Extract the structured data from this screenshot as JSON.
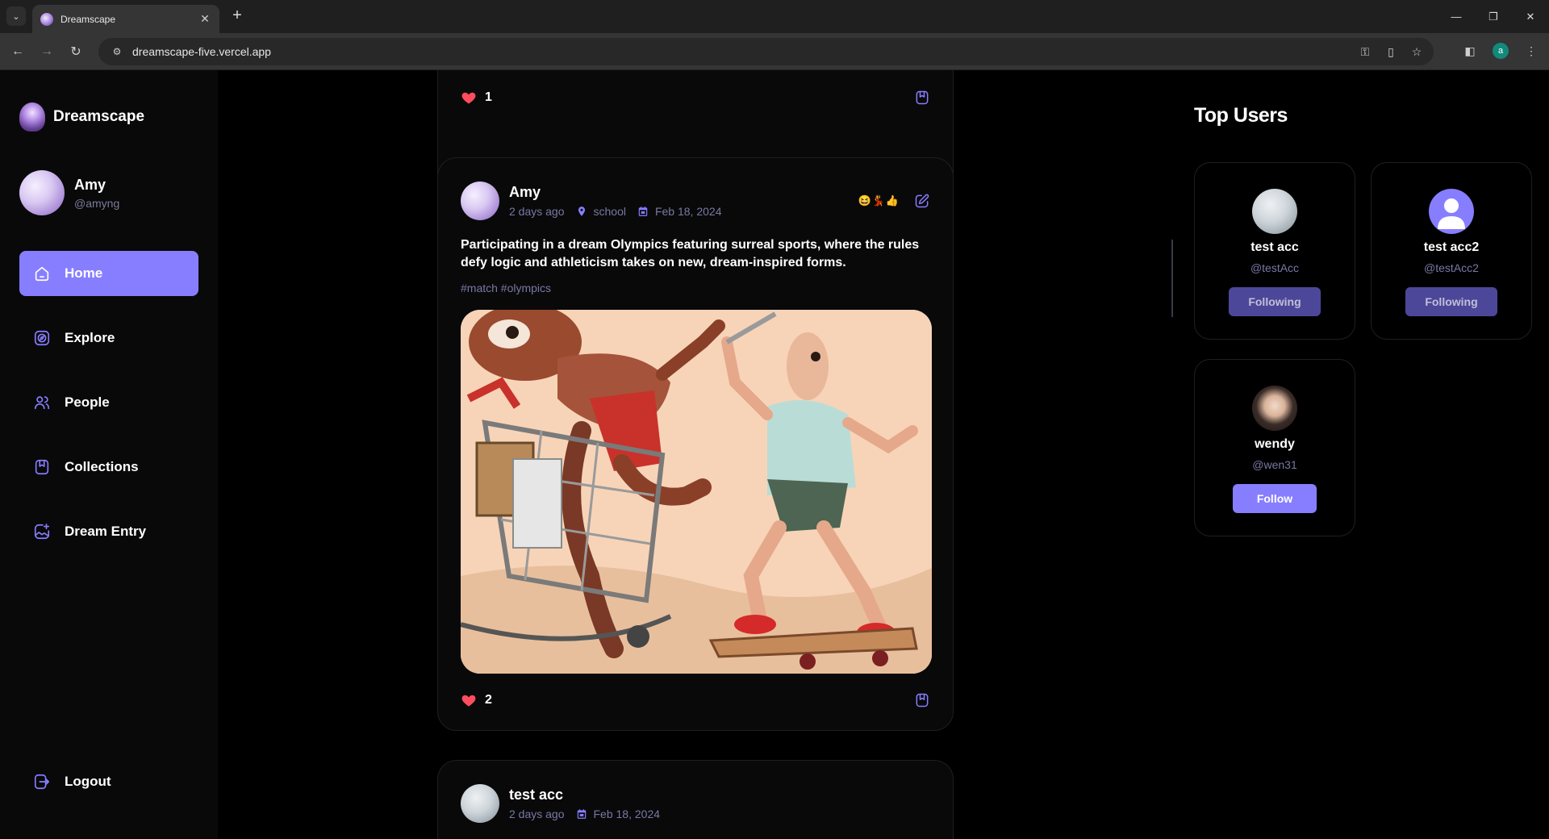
{
  "browser": {
    "tab_title": "Dreamscape",
    "url": "dreamscape-five.vercel.app",
    "profile_initial": "a"
  },
  "sidebar": {
    "brand": "Dreamscape",
    "user": {
      "name": "Amy",
      "handle": "@amyng"
    },
    "nav": [
      {
        "label": "Home",
        "icon": "home-icon",
        "active": true
      },
      {
        "label": "Explore",
        "icon": "explore-icon",
        "active": false
      },
      {
        "label": "People",
        "icon": "people-icon",
        "active": false
      },
      {
        "label": "Collections",
        "icon": "bookmark-icon",
        "active": false
      },
      {
        "label": "Dream Entry",
        "icon": "image-add-icon",
        "active": false
      }
    ],
    "logout": "Logout"
  },
  "feed": {
    "posts": [
      {
        "likes": "1"
      },
      {
        "author": "Amy",
        "time": "2 days ago",
        "location": "school",
        "date": "Feb 18, 2024",
        "emojis": "😆💃👍",
        "caption": "Participating in a dream Olympics featuring surreal sports, where the rules defy logic and athleticism takes on new, dream-inspired forms.",
        "tags": "#match #olympics",
        "likes": "2"
      },
      {
        "author": "test acc",
        "time": "2 days ago",
        "date": "Feb 18, 2024"
      }
    ]
  },
  "top_users": {
    "title": "Top Users",
    "users": [
      {
        "name": "test acc",
        "handle": "@testAcc",
        "button": "Following"
      },
      {
        "name": "test acc2",
        "handle": "@testAcc2",
        "button": "Following"
      },
      {
        "name": "wendy",
        "handle": "@wen31",
        "button": "Follow"
      }
    ]
  },
  "colors": {
    "accent": "#877eff",
    "muted": "#7878a3",
    "heart": "#ff4d5e"
  }
}
